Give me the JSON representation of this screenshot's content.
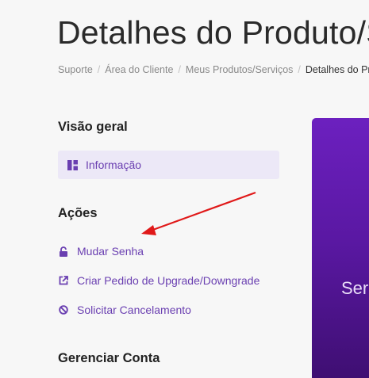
{
  "page": {
    "title": "Detalhes do Produto/Serviço"
  },
  "breadcrumb": [
    {
      "label": "Suporte"
    },
    {
      "label": "Área do Cliente"
    },
    {
      "label": "Meus Produtos/Serviços"
    },
    {
      "label": "Detalhes do Produto"
    }
  ],
  "sidebar": {
    "overview": {
      "heading": "Visão geral",
      "items": [
        {
          "label": "Informação",
          "icon": "dashboard-icon"
        }
      ]
    },
    "actions": {
      "heading": "Ações",
      "items": [
        {
          "label": "Mudar Senha",
          "icon": "lock-icon"
        },
        {
          "label": "Criar Pedido de Upgrade/Downgrade",
          "icon": "external-link-icon"
        },
        {
          "label": "Solicitar Cancelamento",
          "icon": "ban-icon"
        }
      ]
    },
    "manage": {
      "heading": "Gerenciar Conta"
    }
  },
  "panel": {
    "text": "Ser"
  },
  "colors": {
    "accent": "#6a3fb1",
    "active_bg": "#ece8f7",
    "panel_top": "#6c20bf",
    "panel_bottom": "#3d0e6f",
    "annotation_arrow": "#e01919"
  }
}
